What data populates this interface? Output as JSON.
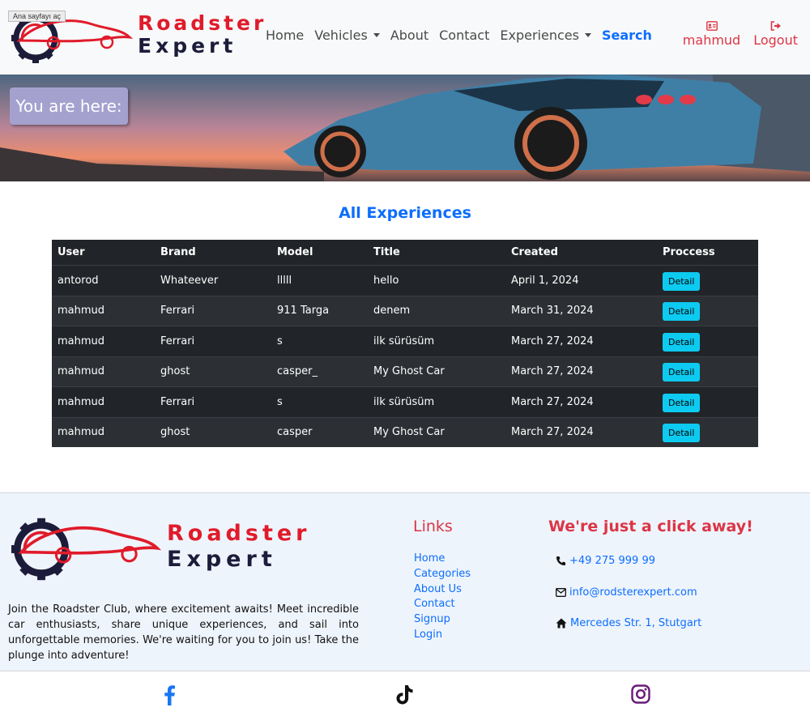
{
  "tooltip": "Ana sayfayı aç",
  "brand": {
    "word1": "Roadster",
    "word2": "Expert"
  },
  "nav": {
    "items": [
      {
        "label": "Home"
      },
      {
        "label": "Vehicles"
      },
      {
        "label": "About"
      },
      {
        "label": "Contact"
      },
      {
        "label": "Experiences"
      },
      {
        "label": "Search"
      }
    ],
    "user_label": "mahmud",
    "logout_label": "Logout"
  },
  "hero": {
    "breadcrumb": "You are here:",
    "watermark": "#653332"
  },
  "main": {
    "title": "All Experiences",
    "table": {
      "headers": [
        "User",
        "Brand",
        "Model",
        "Title",
        "Created",
        "Proccess"
      ],
      "rows": [
        [
          "antorod",
          "Whateever",
          "lllll",
          "hello",
          "April 1, 2024",
          "Detail"
        ],
        [
          "mahmud",
          "Ferrari",
          "911 Targa",
          "denem",
          "March 31, 2024",
          "Detail"
        ],
        [
          "mahmud",
          "Ferrari",
          "s",
          "ilk sürüsüm",
          "March 27, 2024",
          "Detail"
        ],
        [
          "mahmud",
          "ghost",
          "casper_",
          "My Ghost Car",
          "March 27, 2024",
          "Detail"
        ],
        [
          "mahmud",
          "Ferrari",
          "s",
          "ilk sürüsüm",
          "March 27, 2024",
          "Detail"
        ],
        [
          "mahmud",
          "ghost",
          "casper",
          "My Ghost Car",
          "March 27, 2024",
          "Detail"
        ]
      ]
    }
  },
  "footer": {
    "about": "Join the Roadster Club, where excitement awaits! Meet incredible car enthusiasts, share unique experiences, and sail into unforgettable memories. We're waiting for you to join us! Take the plunge into adventure!",
    "links_title": "Links",
    "links": [
      "Home",
      "Categories",
      "About Us",
      "Contact",
      "Signup",
      "Login"
    ],
    "contact_title": "We're just a click away!",
    "phone": "+49 275 999 99",
    "email": "info@rodsterexpert.com",
    "address": "Mercedes Str. 1, Stutgart"
  },
  "social": {
    "icons": [
      "facebook-icon",
      "tiktok-icon",
      "instagram-icon"
    ]
  },
  "colors": {
    "accent_blue": "#0d6efd",
    "accent_red": "#dc3545",
    "detail_button": "#0dcaf0",
    "table_bg": "#212529"
  }
}
